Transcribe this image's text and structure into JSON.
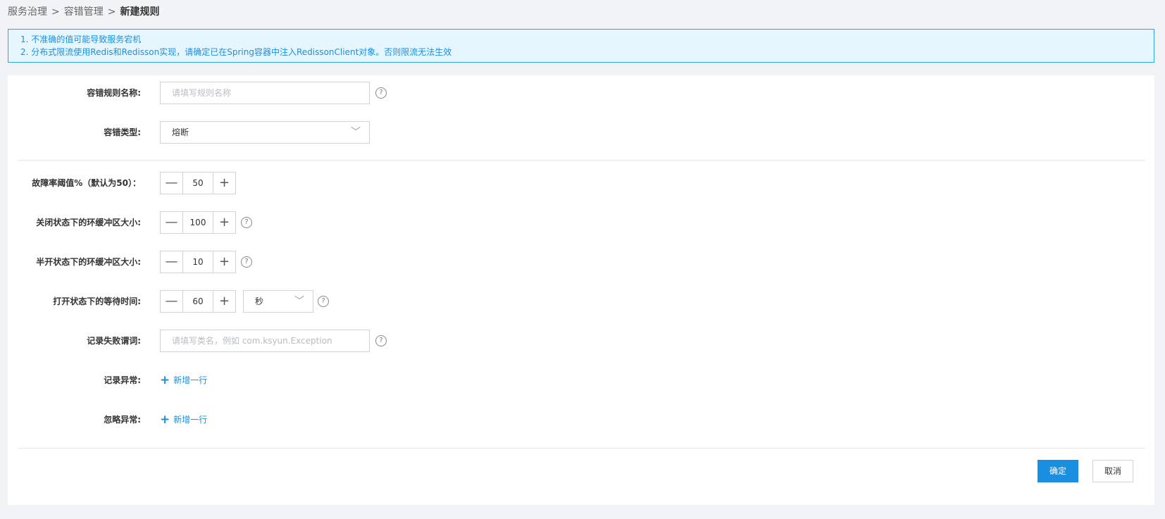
{
  "breadcrumb": {
    "items": [
      "服务治理",
      "容错管理"
    ],
    "separator": ">",
    "current": "新建规则"
  },
  "notice": {
    "lines": [
      "1. 不准确的值可能导致服务宕机",
      "2. 分布式限流使用Redis和Redisson实现，请确定已在Spring容器中注入RedissonClient对象。否则限流无法生效"
    ]
  },
  "form": {
    "rule_name": {
      "label": "容错规则名称:",
      "placeholder": "请填写规则名称",
      "value": ""
    },
    "fault_type": {
      "label": "容错类型:",
      "selected": "熔断"
    },
    "failure_rate": {
      "label": "故障率阈值%（默认为50）：",
      "value": "50"
    },
    "closed_buffer": {
      "label": "关闭状态下的环缓冲区大小:",
      "value": "100"
    },
    "half_open_buffer": {
      "label": "半开状态下的环缓冲区大小:",
      "value": "10"
    },
    "open_wait": {
      "label": "打开状态下的等待时间:",
      "value": "60",
      "unit": "秒"
    },
    "failure_predicate": {
      "label": "记录失败谓词:",
      "placeholder": "请填写类名，例如 com.ksyun.Exception",
      "value": ""
    },
    "record_exceptions": {
      "label": "记录异常:",
      "add_label": "新增一行"
    },
    "ignore_exceptions": {
      "label": "忽略异常:",
      "add_label": "新增一行"
    }
  },
  "actions": {
    "confirm": "确定",
    "cancel": "取消"
  },
  "icons": {
    "help": "question-circle-icon",
    "minus": "minus-icon",
    "plus": "plus-icon",
    "chevron": "chevron-down-icon"
  },
  "colors": {
    "primary": "#1a8fdf",
    "notice_bg": "#e6f6fe",
    "notice_border": "#29a6e8",
    "page_bg": "#f2f3f7"
  }
}
